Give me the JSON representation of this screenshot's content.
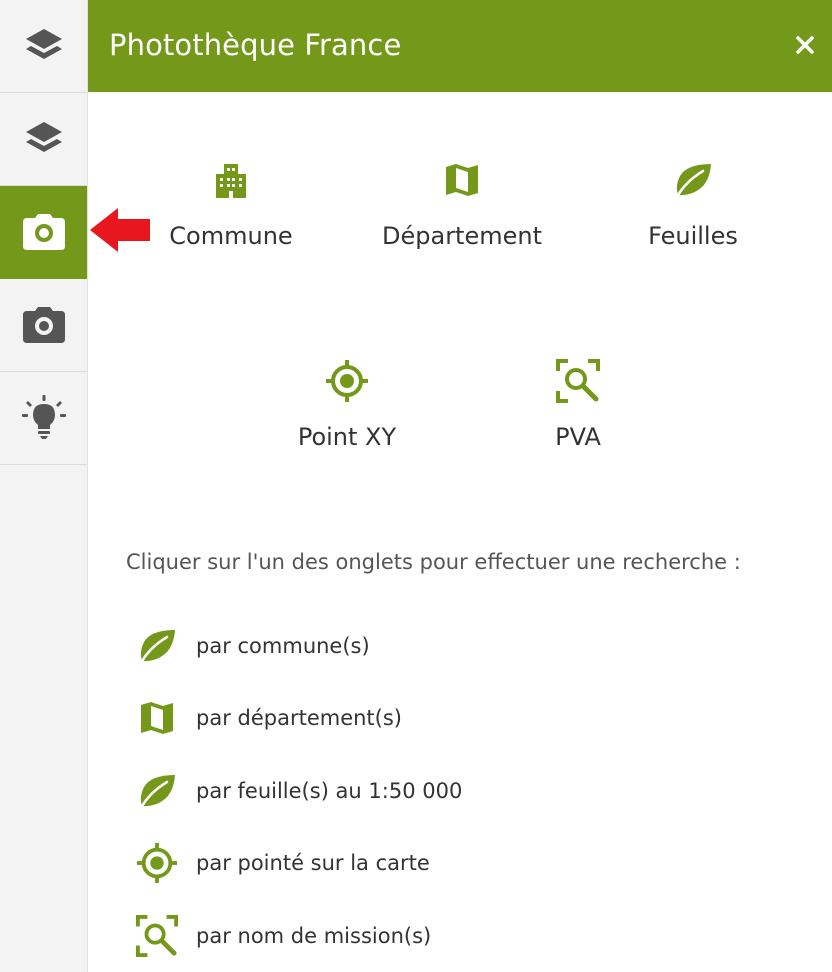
{
  "colors": {
    "accent": "#73981a",
    "sidebar_bg": "#f3f3f3",
    "icon_dark": "#555555",
    "arrow": "#e8161f"
  },
  "sidebar": {
    "items": [
      {
        "name": "layers",
        "icon": "layers-icon"
      },
      {
        "name": "layers-2",
        "icon": "layers-icon"
      },
      {
        "name": "phototheque",
        "icon": "camera-icon",
        "active": true
      },
      {
        "name": "camera-2",
        "icon": "camera-icon"
      },
      {
        "name": "tips",
        "icon": "lightbulb-icon"
      }
    ]
  },
  "header": {
    "title": "Photothèque France",
    "close_icon": "close-icon"
  },
  "tabs": [
    {
      "label": "Commune",
      "icon": "building-icon"
    },
    {
      "label": "Département",
      "icon": "map-icon"
    },
    {
      "label": "Feuilles",
      "icon": "leaf-icon"
    },
    {
      "label": "Point XY",
      "icon": "crosshair-icon"
    },
    {
      "label": "PVA",
      "icon": "zoom-search-icon"
    }
  ],
  "hint": "Cliquer sur l'un des onglets pour effectuer une recherche :",
  "options": [
    {
      "label": "par commune(s)",
      "icon": "leaf-icon"
    },
    {
      "label": "par département(s)",
      "icon": "map-icon"
    },
    {
      "label": "par feuille(s) au 1:50 000",
      "icon": "leaf-icon"
    },
    {
      "label": "par pointé sur la carte",
      "icon": "crosshair-icon"
    },
    {
      "label": "par nom de mission(s)",
      "icon": "zoom-search-icon"
    }
  ]
}
